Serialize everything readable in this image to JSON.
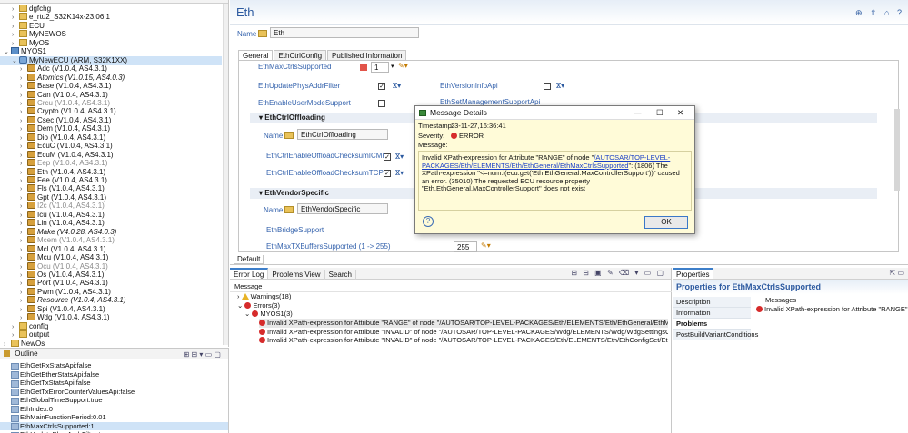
{
  "tree": {
    "items": [
      {
        "label": "dgfchg",
        "indent": 1,
        "icon": "folder",
        "style": ""
      },
      {
        "label": "e_rtu2_S32K14x-23.06.1",
        "indent": 1,
        "icon": "folder",
        "style": ""
      },
      {
        "label": "ECU",
        "indent": 1,
        "icon": "folder",
        "style": ""
      },
      {
        "label": "MyNEWOS",
        "indent": 1,
        "icon": "folder",
        "style": ""
      },
      {
        "label": "MyOS",
        "indent": 1,
        "icon": "folder",
        "style": ""
      },
      {
        "label": "MYOS1",
        "indent": 0,
        "icon": "proj",
        "style": ""
      },
      {
        "label": "MyNewECU (ARM, S32K1XX)",
        "indent": 1,
        "icon": "ecu",
        "style": "sel"
      },
      {
        "label": "Adc (V1.0.4, AS4.3.1)",
        "indent": 2,
        "icon": "mod",
        "style": ""
      },
      {
        "label": "Atomics (V1.0.15, AS4.0.3)",
        "indent": 2,
        "icon": "mod",
        "style": "ital"
      },
      {
        "label": "Base (V1.0.4, AS4.3.1)",
        "indent": 2,
        "icon": "mod",
        "style": ""
      },
      {
        "label": "Can (V1.0.4, AS4.3.1)",
        "indent": 2,
        "icon": "mod",
        "style": ""
      },
      {
        "label": "Crcu (V1.0.4, AS4.3.1)",
        "indent": 2,
        "icon": "mod",
        "style": "gray"
      },
      {
        "label": "Crypto (V1.0.4, AS4.3.1)",
        "indent": 2,
        "icon": "mod",
        "style": ""
      },
      {
        "label": "Csec (V1.0.4, AS4.3.1)",
        "indent": 2,
        "icon": "mod",
        "style": ""
      },
      {
        "label": "Dem (V1.0.4, AS4.3.1)",
        "indent": 2,
        "icon": "mod",
        "style": ""
      },
      {
        "label": "Dio (V1.0.4, AS4.3.1)",
        "indent": 2,
        "icon": "mod",
        "style": ""
      },
      {
        "label": "EcuC (V1.0.4, AS4.3.1)",
        "indent": 2,
        "icon": "mod",
        "style": ""
      },
      {
        "label": "EcuM (V1.0.4, AS4.3.1)",
        "indent": 2,
        "icon": "mod",
        "style": ""
      },
      {
        "label": "Eep (V1.0.4, AS4.3.1)",
        "indent": 2,
        "icon": "mod",
        "style": "gray"
      },
      {
        "label": "Eth (V1.0.4, AS4.3.1)",
        "indent": 2,
        "icon": "mod",
        "style": ""
      },
      {
        "label": "Fee (V1.0.4, AS4.3.1)",
        "indent": 2,
        "icon": "mod",
        "style": ""
      },
      {
        "label": "Fls (V1.0.4, AS4.3.1)",
        "indent": 2,
        "icon": "mod",
        "style": ""
      },
      {
        "label": "Gpt (V1.0.4, AS4.3.1)",
        "indent": 2,
        "icon": "mod",
        "style": ""
      },
      {
        "label": "I2c (V1.0.4, AS4.3.1)",
        "indent": 2,
        "icon": "mod",
        "style": "gray"
      },
      {
        "label": "Icu (V1.0.4, AS4.3.1)",
        "indent": 2,
        "icon": "mod",
        "style": ""
      },
      {
        "label": "Lin (V1.0.4, AS4.3.1)",
        "indent": 2,
        "icon": "mod",
        "style": ""
      },
      {
        "label": "Make (V4.0.28, AS4.0.3)",
        "indent": 2,
        "icon": "mod",
        "style": "ital"
      },
      {
        "label": "Mcem (V1.0.4, AS4.3.1)",
        "indent": 2,
        "icon": "mod",
        "style": "gray"
      },
      {
        "label": "Mcl (V1.0.4, AS4.3.1)",
        "indent": 2,
        "icon": "mod",
        "style": ""
      },
      {
        "label": "Mcu (V1.0.4, AS4.3.1)",
        "indent": 2,
        "icon": "mod",
        "style": ""
      },
      {
        "label": "Ocu (V1.0.4, AS4.3.1)",
        "indent": 2,
        "icon": "mod",
        "style": "gray"
      },
      {
        "label": "Os (V1.0.4, AS4.3.1)",
        "indent": 2,
        "icon": "mod",
        "style": ""
      },
      {
        "label": "Port (V1.0.4, AS4.3.1)",
        "indent": 2,
        "icon": "mod",
        "style": ""
      },
      {
        "label": "Pwm (V1.0.4, AS4.3.1)",
        "indent": 2,
        "icon": "mod",
        "style": ""
      },
      {
        "label": "Resource (V1.0.4, AS4.3.1)",
        "indent": 2,
        "icon": "mod",
        "style": "ital"
      },
      {
        "label": "Spi (V1.0.4, AS4.3.1)",
        "indent": 2,
        "icon": "mod",
        "style": ""
      },
      {
        "label": "Wdg (V1.0.4, AS4.3.1)",
        "indent": 2,
        "icon": "mod",
        "style": ""
      },
      {
        "label": "config",
        "indent": 1,
        "icon": "folder",
        "style": ""
      },
      {
        "label": "output",
        "indent": 1,
        "icon": "folder",
        "style": ""
      },
      {
        "label": "NewOs",
        "indent": 0,
        "icon": "folder",
        "style": ""
      }
    ]
  },
  "outline": {
    "tab": "Outline",
    "items": [
      "EthGetRxStatsApi:false",
      "EthGetEtherStatsApi:false",
      "EthGetTxStatsApi:false",
      "EthGetTxErrorCounterValuesApi:false",
      "EthGlobalTimeSupport:true",
      "EthIndex:0",
      "EthMainFunctionPeriod:0.01",
      "EthMaxCtrlsSupported:1",
      "EthUpdatePhysAddrFilter:true"
    ]
  },
  "editor": {
    "title": "Eth",
    "name_label": "Name",
    "name_value": "Eth",
    "tabs": [
      "General",
      "EthCtrlConfig",
      "Published Information"
    ],
    "fields": {
      "max_ctrls": "EthMaxCtrlsSupported",
      "max_ctrls_value": "1",
      "update_phys": "EthUpdatePhysAddrFilter",
      "enable_user_mode": "EthEnableUserModeSupport",
      "version_info": "EthVersionInfoApi",
      "set_mgmt": "EthSetManagementSupportApi"
    },
    "section1": "EthCtrlOffloading",
    "section1_name": "EthCtrlOffloading",
    "checksum_icmp": "EthCtrlEnableOffloadChecksumICMP",
    "checksum_tcp": "EthCtrlEnableOffloadChecksumTCP",
    "section2": "EthVendorSpecific",
    "section2_name": "EthVendorSpecific",
    "bridge": "EthBridgeSupport",
    "max_tx": "EthMaxTXBuffersSupported (1 -> 255)",
    "max_tx_value": "255",
    "default_tab": "Default"
  },
  "problems": {
    "tabs": [
      "Error Log",
      "Problems View",
      "Search"
    ],
    "column": "Message",
    "warnings": "Warnings(18)",
    "errors": "Errors(3)",
    "group": "MYOS1(3)",
    "rows": [
      "Invalid XPath-expression for Attribute \"RANGE\" of node \"/AUTOSAR/TOP-LEVEL-PACKAGES/Eth/ELEMENTS/Eth/EthGeneral/EthMaxCtrlsSupported\": (1806",
      "Invalid XPath-expression for Attribute \"INVALID\" of node \"/AUTOSAR/TOP-LEVEL-PACKAGES/Wdg/ELEMENTS/Wdg/WdgSettingsConfig/WdgSettingsCom",
      "Invalid XPath-expression for Attribute \"INVALID\" of node \"/AUTOSAR/TOP-LEVEL-PACKAGES/Eth/ELEMENTS/Eth/EthConfigSet/EthCtrlConfig/EthCtrlConf"
    ]
  },
  "properties": {
    "tab": "Properties",
    "title": "Properties for EthMaxCtrlsSupported",
    "side": [
      "Description",
      "Information",
      "Problems",
      "PostBuildVariantConditions"
    ],
    "col": "Messages",
    "msg": "Invalid XPath-expression for Attribute \"RANGE\" of node \""
  },
  "dialog": {
    "title": "Message Details",
    "timestamp_label": "Timestamp:",
    "timestamp": "23-11-27,16:36:41",
    "severity_label": "Severity:",
    "severity": "ERROR",
    "message_label": "Message:",
    "msg_a": "Invalid XPath-expression for Attribute \"RANGE\" of node \"",
    "msg_link": "/AUTOSAR/TOP-LEVEL-PACKAGES/Eth/ELEMENTS/Eth/EthGeneral/EthMaxCtrlsSupported",
    "msg_b": "\": (1806) The XPath-expression \"<=num:i(ecu:get('Eth.EthGeneral.MaxControllerSupport'))\" caused an error. (35010) The requested ECU resource property \"Eth.EthGeneral.MaxControllerSupport\" does not exist",
    "ok": "OK"
  }
}
